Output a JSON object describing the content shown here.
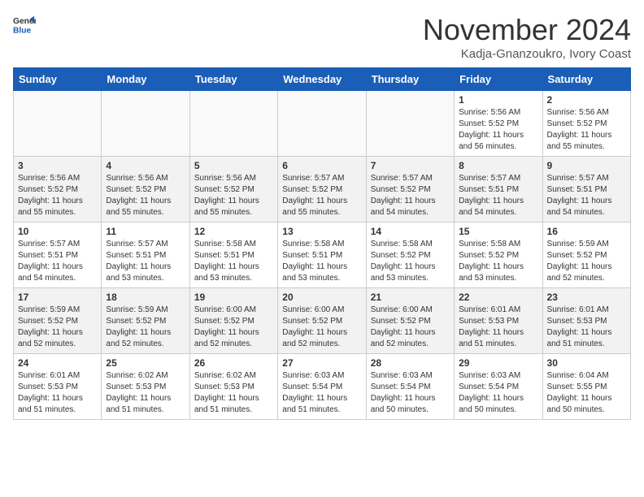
{
  "header": {
    "logo_line1": "General",
    "logo_line2": "Blue",
    "month_title": "November 2024",
    "location": "Kadja-Gnanzoukro, Ivory Coast"
  },
  "weekdays": [
    "Sunday",
    "Monday",
    "Tuesday",
    "Wednesday",
    "Thursday",
    "Friday",
    "Saturday"
  ],
  "weeks": [
    [
      {
        "day": "",
        "info": ""
      },
      {
        "day": "",
        "info": ""
      },
      {
        "day": "",
        "info": ""
      },
      {
        "day": "",
        "info": ""
      },
      {
        "day": "",
        "info": ""
      },
      {
        "day": "1",
        "info": "Sunrise: 5:56 AM\nSunset: 5:52 PM\nDaylight: 11 hours\nand 56 minutes."
      },
      {
        "day": "2",
        "info": "Sunrise: 5:56 AM\nSunset: 5:52 PM\nDaylight: 11 hours\nand 55 minutes."
      }
    ],
    [
      {
        "day": "3",
        "info": "Sunrise: 5:56 AM\nSunset: 5:52 PM\nDaylight: 11 hours\nand 55 minutes."
      },
      {
        "day": "4",
        "info": "Sunrise: 5:56 AM\nSunset: 5:52 PM\nDaylight: 11 hours\nand 55 minutes."
      },
      {
        "day": "5",
        "info": "Sunrise: 5:56 AM\nSunset: 5:52 PM\nDaylight: 11 hours\nand 55 minutes."
      },
      {
        "day": "6",
        "info": "Sunrise: 5:57 AM\nSunset: 5:52 PM\nDaylight: 11 hours\nand 55 minutes."
      },
      {
        "day": "7",
        "info": "Sunrise: 5:57 AM\nSunset: 5:52 PM\nDaylight: 11 hours\nand 54 minutes."
      },
      {
        "day": "8",
        "info": "Sunrise: 5:57 AM\nSunset: 5:51 PM\nDaylight: 11 hours\nand 54 minutes."
      },
      {
        "day": "9",
        "info": "Sunrise: 5:57 AM\nSunset: 5:51 PM\nDaylight: 11 hours\nand 54 minutes."
      }
    ],
    [
      {
        "day": "10",
        "info": "Sunrise: 5:57 AM\nSunset: 5:51 PM\nDaylight: 11 hours\nand 54 minutes."
      },
      {
        "day": "11",
        "info": "Sunrise: 5:57 AM\nSunset: 5:51 PM\nDaylight: 11 hours\nand 53 minutes."
      },
      {
        "day": "12",
        "info": "Sunrise: 5:58 AM\nSunset: 5:51 PM\nDaylight: 11 hours\nand 53 minutes."
      },
      {
        "day": "13",
        "info": "Sunrise: 5:58 AM\nSunset: 5:51 PM\nDaylight: 11 hours\nand 53 minutes."
      },
      {
        "day": "14",
        "info": "Sunrise: 5:58 AM\nSunset: 5:52 PM\nDaylight: 11 hours\nand 53 minutes."
      },
      {
        "day": "15",
        "info": "Sunrise: 5:58 AM\nSunset: 5:52 PM\nDaylight: 11 hours\nand 53 minutes."
      },
      {
        "day": "16",
        "info": "Sunrise: 5:59 AM\nSunset: 5:52 PM\nDaylight: 11 hours\nand 52 minutes."
      }
    ],
    [
      {
        "day": "17",
        "info": "Sunrise: 5:59 AM\nSunset: 5:52 PM\nDaylight: 11 hours\nand 52 minutes."
      },
      {
        "day": "18",
        "info": "Sunrise: 5:59 AM\nSunset: 5:52 PM\nDaylight: 11 hours\nand 52 minutes."
      },
      {
        "day": "19",
        "info": "Sunrise: 6:00 AM\nSunset: 5:52 PM\nDaylight: 11 hours\nand 52 minutes."
      },
      {
        "day": "20",
        "info": "Sunrise: 6:00 AM\nSunset: 5:52 PM\nDaylight: 11 hours\nand 52 minutes."
      },
      {
        "day": "21",
        "info": "Sunrise: 6:00 AM\nSunset: 5:52 PM\nDaylight: 11 hours\nand 52 minutes."
      },
      {
        "day": "22",
        "info": "Sunrise: 6:01 AM\nSunset: 5:53 PM\nDaylight: 11 hours\nand 51 minutes."
      },
      {
        "day": "23",
        "info": "Sunrise: 6:01 AM\nSunset: 5:53 PM\nDaylight: 11 hours\nand 51 minutes."
      }
    ],
    [
      {
        "day": "24",
        "info": "Sunrise: 6:01 AM\nSunset: 5:53 PM\nDaylight: 11 hours\nand 51 minutes."
      },
      {
        "day": "25",
        "info": "Sunrise: 6:02 AM\nSunset: 5:53 PM\nDaylight: 11 hours\nand 51 minutes."
      },
      {
        "day": "26",
        "info": "Sunrise: 6:02 AM\nSunset: 5:53 PM\nDaylight: 11 hours\nand 51 minutes."
      },
      {
        "day": "27",
        "info": "Sunrise: 6:03 AM\nSunset: 5:54 PM\nDaylight: 11 hours\nand 51 minutes."
      },
      {
        "day": "28",
        "info": "Sunrise: 6:03 AM\nSunset: 5:54 PM\nDaylight: 11 hours\nand 50 minutes."
      },
      {
        "day": "29",
        "info": "Sunrise: 6:03 AM\nSunset: 5:54 PM\nDaylight: 11 hours\nand 50 minutes."
      },
      {
        "day": "30",
        "info": "Sunrise: 6:04 AM\nSunset: 5:55 PM\nDaylight: 11 hours\nand 50 minutes."
      }
    ]
  ]
}
